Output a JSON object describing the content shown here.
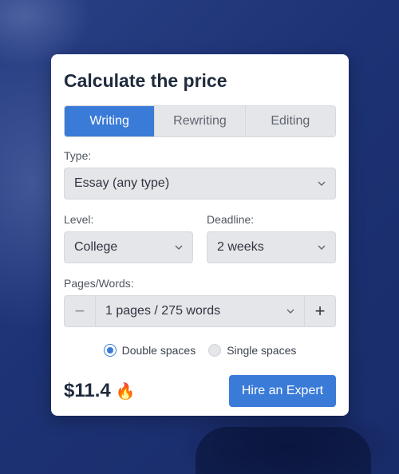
{
  "calculator": {
    "title": "Calculate the price",
    "tabs": [
      {
        "label": "Writing",
        "active": true
      },
      {
        "label": "Rewriting",
        "active": false
      },
      {
        "label": "Editing",
        "active": false
      }
    ],
    "type": {
      "label": "Type:",
      "value": "Essay (any type)"
    },
    "level": {
      "label": "Level:",
      "value": "College"
    },
    "deadline": {
      "label": "Deadline:",
      "value": "2 weeks"
    },
    "pages": {
      "label": "Pages/Words:",
      "value": "1 pages / 275 words",
      "minus": "−",
      "plus": "+"
    },
    "spacing": [
      {
        "label": "Double spaces",
        "selected": true
      },
      {
        "label": "Single spaces",
        "selected": false
      }
    ],
    "price": "$11.4",
    "price_icon": "fire-icon",
    "price_emoji": "🔥",
    "hire_button": "Hire an Expert"
  },
  "colors": {
    "accent": "#3b7bd8",
    "background": "#1b2f6e"
  }
}
